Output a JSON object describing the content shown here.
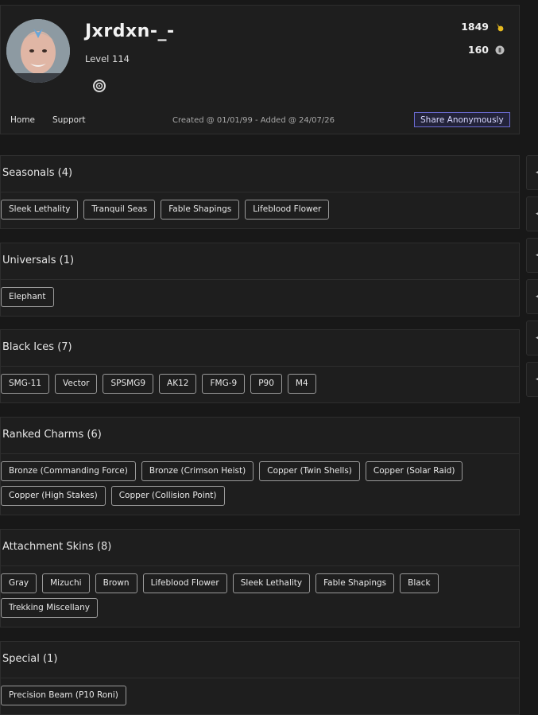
{
  "profile": {
    "username": "Jxrdxn-_-",
    "level": "Level 114",
    "stats": [
      {
        "value": "1849",
        "icon": "gold-medal-icon"
      },
      {
        "value": "160",
        "icon": "coin-icon"
      }
    ],
    "nav": [
      "Home",
      "Support"
    ],
    "created": "Created @ 01/01/99 - Added @ 24/07/26",
    "share_label": "Share Anonymously"
  },
  "sections": [
    {
      "title": "Seasonals (4)",
      "items": [
        "Sleek Lethality",
        "Tranquil Seas",
        "Fable Shapings",
        "Lifeblood Flower"
      ]
    },
    {
      "title": "Universals (1)",
      "items": [
        "Elephant"
      ]
    },
    {
      "title": "Black Ices (7)",
      "items": [
        "SMG-11",
        "Vector",
        "SPSMG9",
        "AK12",
        "FMG-9",
        "P90",
        "M4"
      ]
    },
    {
      "title": "Ranked Charms (6)",
      "items": [
        "Bronze (Commanding Force)",
        "Bronze (Crimson Heist)",
        "Copper (Twin Shells)",
        "Copper (Solar Raid)",
        "Copper (High Stakes)",
        "Copper (Collision Point)"
      ]
    },
    {
      "title": "Attachment Skins (8)",
      "items": [
        "Gray",
        "Mizuchi",
        "Brown",
        "Lifeblood Flower",
        "Sleek Lethality",
        "Fable Shapings",
        "Black",
        "Trekking Miscellany"
      ]
    },
    {
      "title": "Special (1)",
      "items": [
        "Precision Beam (P10 Roni)"
      ]
    }
  ],
  "colors": {
    "accent": "#6b6bd1",
    "background": "#181818",
    "panel": "#1e1e1e"
  }
}
